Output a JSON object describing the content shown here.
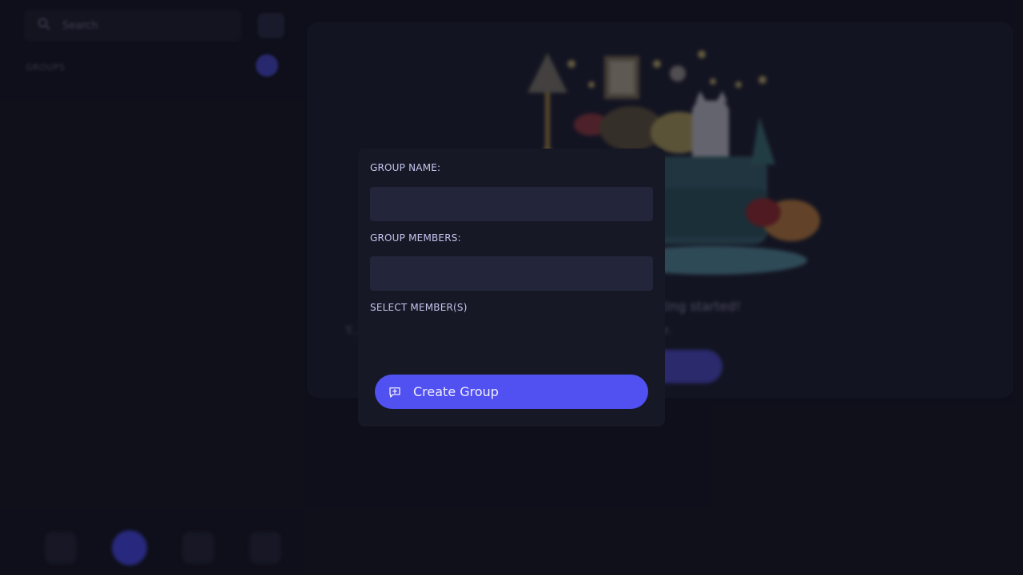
{
  "sidebar": {
    "search_placeholder": "Search",
    "section_label": "GROUPS"
  },
  "modal": {
    "group_name_label": "GROUP NAME:",
    "group_name_value": "",
    "group_members_label": "GROUP MEMBERS:",
    "group_members_value": "",
    "select_members_label": "SELECT MEMBER(S)",
    "create_button_label": "Create Group",
    "create_button_icon": "chat-plus-icon"
  },
  "main": {
    "empty_title": "...ting started!",
    "empty_subtitle": "Y... search friends or head to the friends page to start one.",
    "illustration": "cozy-room-illustration"
  },
  "colors": {
    "background": "#12131f",
    "modal": "#171826",
    "field": "#23253a",
    "accent": "#5150f0",
    "label": "#c4c6ee"
  }
}
